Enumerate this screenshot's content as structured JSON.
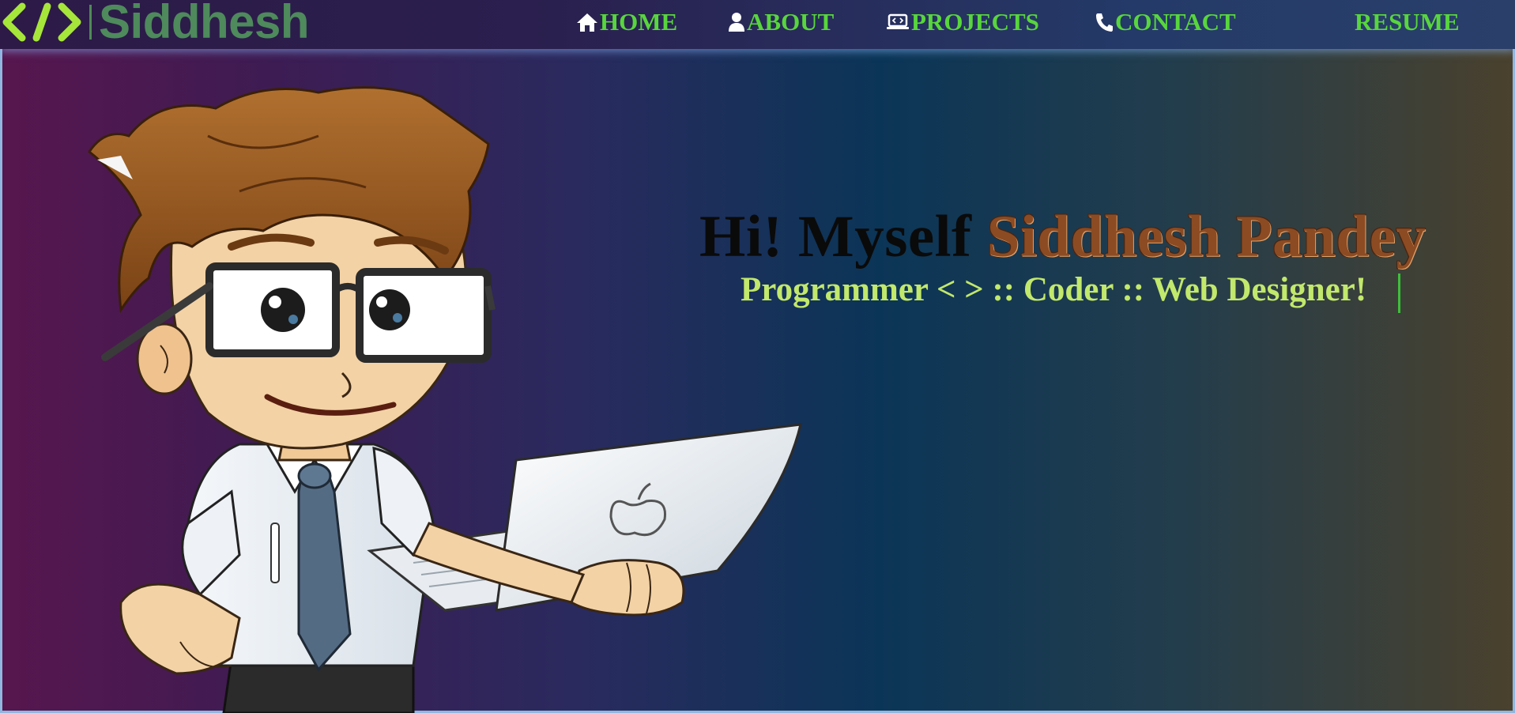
{
  "brand": {
    "logo_icon": "code-brackets-icon",
    "name": "Siddhesh",
    "colors": {
      "logo_mark": "#a6e63a",
      "logo_text": "#4e8a5c"
    }
  },
  "nav": {
    "items": [
      {
        "label": "HOME",
        "icon": "home-icon"
      },
      {
        "label": "ABOUT",
        "icon": "person-icon"
      },
      {
        "label": "PROJECTS",
        "icon": "laptop-code-icon"
      },
      {
        "label": "CONTACT",
        "icon": "phone-icon"
      },
      {
        "label": "RESUME",
        "icon": ""
      }
    ],
    "color": "#58d63c"
  },
  "hero": {
    "greeting": "Hi! Myself",
    "name": "Siddhesh Pandey",
    "subtitle": "Programmer < > :: Coder :: Web Designer!",
    "illustration": "cartoon developer with glasses holding laptop",
    "colors": {
      "greeting": "#0a0a0a",
      "name": "#8c4b22",
      "subtitle": "#c2e86c",
      "caret": "#3dbf3a"
    }
  }
}
